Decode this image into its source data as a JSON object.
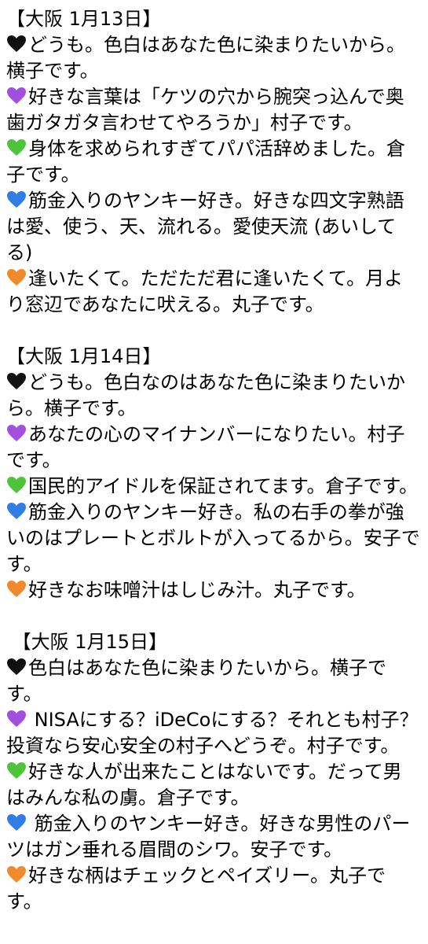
{
  "colors": {
    "text": "#000000",
    "background": "#ffffff",
    "heart_black": "#111111",
    "heart_purple": "#a24fe0",
    "heart_green": "#4dc43a",
    "heart_blue": "#2f7de6",
    "heart_orange": "#f08a2a"
  },
  "sections": [
    {
      "header": "【大阪 1月13日】",
      "entries": [
        {
          "heart": "black-heart-icon",
          "text": "どうも。色白はあなた色に染まりたいから。横子です。"
        },
        {
          "heart": "purple-heart-icon",
          "text": "好きな言葉は「ケツの穴から腕突っ込んで奥歯ガタガタ言わせてやろうか」村子です。"
        },
        {
          "heart": "green-heart-icon",
          "text": "身体を求められすぎてパパ活辞めました。倉子です。"
        },
        {
          "heart": "blue-heart-icon",
          "text": "筋金入りのヤンキー好き。好きな四文字熟語は愛、使う、天、流れる。愛使天流 (あいしてる)"
        },
        {
          "heart": "orange-heart-icon",
          "text": "逢いたくて。ただただ君に逢いたくて。月より窓辺であなたに吠える。丸子です。"
        }
      ]
    },
    {
      "header": "【大阪 1月14日】",
      "entries": [
        {
          "heart": "black-heart-icon",
          "text": "どうも。色白なのはあなた色に染まりたいから。横子です。"
        },
        {
          "heart": "purple-heart-icon",
          "text": "あなたの心のマイナンバーになりたい。村子です。"
        },
        {
          "heart": "green-heart-icon",
          "text": "国民的アイドルを保証されてます。倉子です。"
        },
        {
          "heart": "blue-heart-icon",
          "text": "筋金入りのヤンキー好き。私の右手の拳が強いのはプレートとボルトが入ってるから。安子です。"
        },
        {
          "heart": "orange-heart-icon",
          "text": "好きなお味噌汁はしじみ汁。丸子です。"
        }
      ]
    },
    {
      "header": " 【大阪 1月15日】",
      "entries": [
        {
          "heart": "black-heart-icon",
          "text": "色白はあなた色に染まりたいから。横子です。"
        },
        {
          "heart": "purple-heart-icon",
          "text": " NISAにする？iDeCoにする？それとも村子？投資なら安心安全の村子へどうぞ。村子です。"
        },
        {
          "heart": "green-heart-icon",
          "text": "好きな人が出来たことはないです。だって男はみんな私の虜。倉子です。"
        },
        {
          "heart": "blue-heart-icon",
          "text": " 筋金入りのヤンキー好き。好きな男性のパーツはガン垂れる眉間のシワ。安子です。"
        },
        {
          "heart": "orange-heart-icon",
          "text": "好きな柄はチェックとペイズリー。丸子です。"
        }
      ]
    }
  ]
}
